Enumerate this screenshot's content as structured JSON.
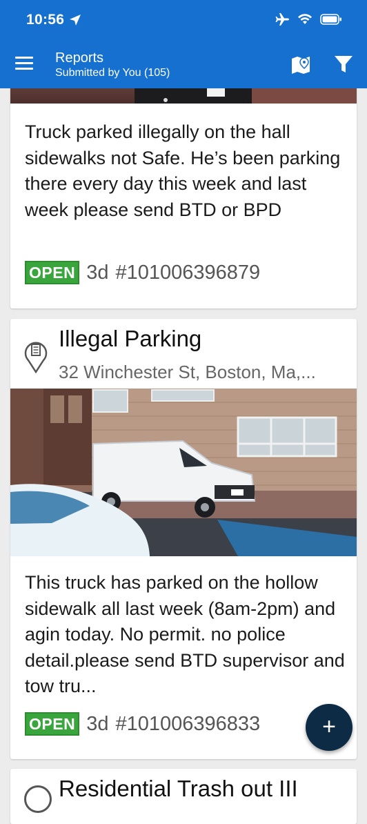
{
  "status_bar": {
    "time": "10:56"
  },
  "header": {
    "title": "Reports",
    "subtitle": "Submitted by You (105)"
  },
  "reports": [
    {
      "description": "Truck parked illegally on the hall sidewalks not Safe. He’s been parking there every day this week and last week please send BTD or BPD",
      "status": "OPEN",
      "age": "3d",
      "id": "#101006396879"
    },
    {
      "title": "Illegal Parking",
      "address": "32 Winchester St, Boston, Ma,...",
      "description": "This truck has parked on the hollow sidewalk all last week (8am-2pm) and agin today. No permit. no police detail.please send BTD supervisor and tow tru...",
      "status": "OPEN",
      "age": "3d",
      "id": "#101006396833"
    },
    {
      "title": "Residential Trash out III"
    }
  ],
  "fab": {
    "label": "+"
  },
  "colors": {
    "header": "#1670cf",
    "open_badge": "#3aa53c",
    "fab": "#0d2b45"
  }
}
